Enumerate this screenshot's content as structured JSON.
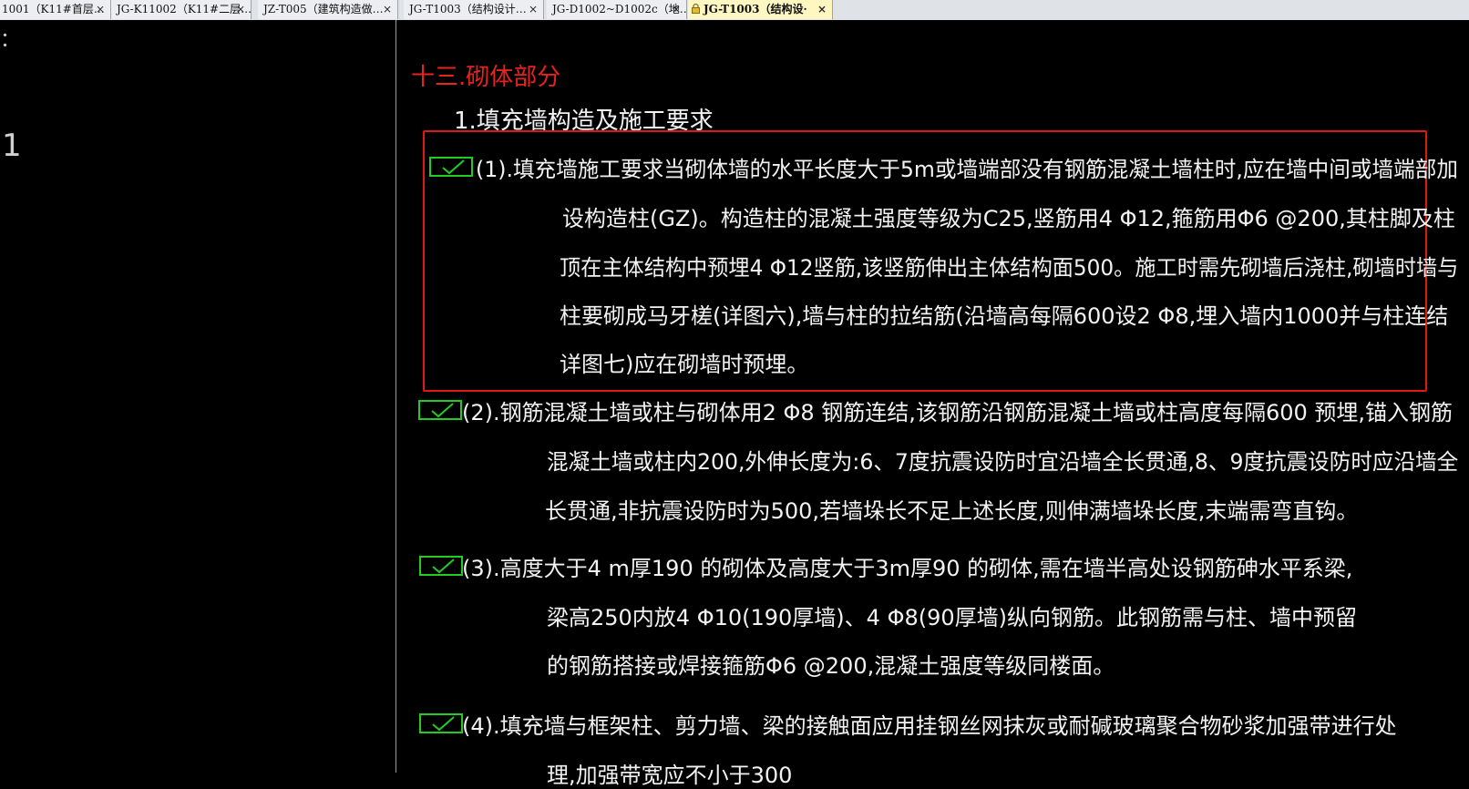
{
  "tabs": [
    {
      "label": "1001（K11#首层…",
      "close": "×",
      "active": false
    },
    {
      "label": "JG-K11002（K11#二层…",
      "close": "×",
      "active": false
    },
    {
      "label": "JZ-T005（建筑构造做…",
      "close": "×",
      "active": false
    },
    {
      "label": "JG-T1003（结构设计…",
      "close": "×",
      "active": false
    },
    {
      "label": "JG-D1002~D1002c（地…",
      "close": "×",
      "active": false
    },
    {
      "label": "JG-T1003（结构设·",
      "close": "×",
      "active": true
    }
  ],
  "left_marks": {
    "top": "：",
    "mid": "1"
  },
  "drawing": {
    "section_title": "十三.砌体部分",
    "subsection": "1.填充墙构造及施工要求",
    "items": [
      {
        "lines": [
          "(1).填充墙施工要求当砌体墙的水平长度大于5m或墙端部没有钢筋混凝土墙柱时,应在墙中间或墙端部加",
          "设构造柱(GZ)。构造柱的混凝土强度等级为C25,竖筋用4 Φ12,箍筋用Φ6 @200,其柱脚及柱",
          "顶在主体结构中预埋4 Φ12竖筋,该竖筋伸出主体结构面500。施工时需先砌墙后浇柱,砌墙时墙与",
          "柱要砌成马牙槎(详图六),墙与柱的拉结筋(沿墙高每隔600设2 Φ8,埋入墙内1000并与柱连结",
          "详图七)应在砌墙时预埋。"
        ]
      },
      {
        "lines": [
          "(2).钢筋混凝土墙或柱与砌体用2 Φ8 钢筋连结,该钢筋沿钢筋混凝土墙或柱高度每隔600 预埋,锚入钢筋",
          "混凝土墙或柱内200,外伸长度为:6、7度抗震设防时宜沿墙全长贯通,8、9度抗震设防时应沿墙全",
          "长贯通,非抗震设防时为500,若墙垛长不足上述长度,则伸满墙垛长度,末端需弯直钩。"
        ]
      },
      {
        "lines": [
          "(3).高度大于4 m厚190 的砌体及高度大于3m厚90 的砌体,需在墙半高处设钢筋砷水平系梁,",
          "梁高250内放4 Φ10(190厚墙)、4 Φ8(90厚墙)纵向钢筋。此钢筋需与柱、墙中预留",
          "的钢筋搭接或焊接箍筋Φ6 @200,混凝土强度等级同楼面。"
        ]
      },
      {
        "lines": [
          "(4).填充墙与框架柱、剪力墙、梁的接触面应用挂钢丝网抹灰或耐碱玻璃聚合物砂浆加强带进行处",
          "理,加强带宽应不小于300"
        ]
      }
    ]
  },
  "colors": {
    "canvas_bg": "#000000",
    "text": "#f2f2f2",
    "title": "#e6231e",
    "checkbox": "#22cc22",
    "highlight_box": "#e01818"
  },
  "icons": {
    "checkbox": "checkbox-check-icon",
    "lock": "lock-icon",
    "close": "close-icon"
  }
}
